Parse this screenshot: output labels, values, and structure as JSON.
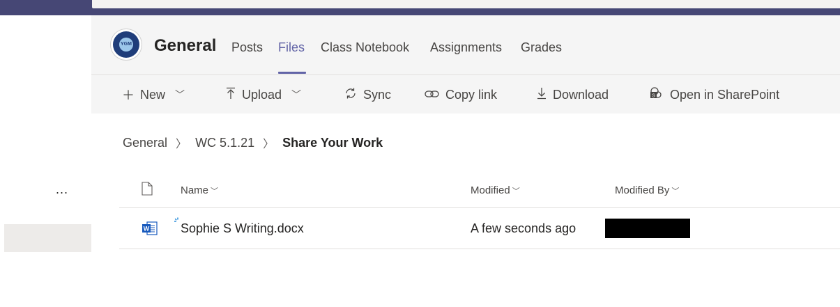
{
  "channel": {
    "title": "General"
  },
  "tabs": [
    {
      "label": "Posts"
    },
    {
      "label": "Files"
    },
    {
      "label": "Class Notebook"
    },
    {
      "label": "Assignments"
    },
    {
      "label": "Grades"
    }
  ],
  "active_tab": "Files",
  "logo": {
    "text": "YGM"
  },
  "rail": {
    "more": "..."
  },
  "toolbar": {
    "new": "New",
    "upload": "Upload",
    "sync": "Sync",
    "copy_link": "Copy link",
    "download": "Download",
    "open_sharepoint": "Open in SharePoint"
  },
  "breadcrumb": {
    "items": [
      "General",
      "WC 5.1.21"
    ],
    "current": "Share Your Work"
  },
  "columns": {
    "name": "Name",
    "modified": "Modified",
    "modified_by": "Modified By"
  },
  "files": [
    {
      "name": "Sophie S Writing.docx",
      "modified": "A few seconds ago",
      "icon": "word-doc-icon"
    }
  ],
  "colors": {
    "accent": "#6264a7",
    "topbar": "#464775",
    "word": "#185abd"
  }
}
